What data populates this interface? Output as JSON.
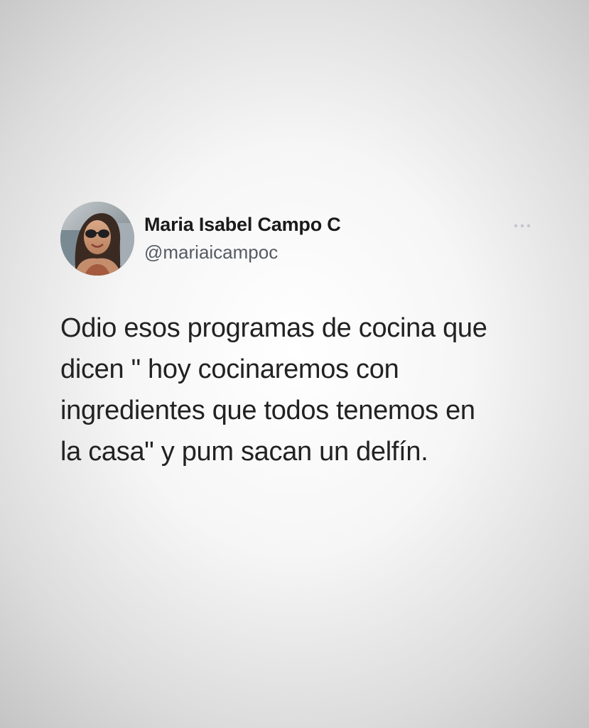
{
  "tweet": {
    "author": {
      "display_name": "Maria Isabel Campo C",
      "handle": "@mariaicampoc",
      "avatar_icon": "profile-photo"
    },
    "more_icon": "more-horizontal-icon",
    "text_lines": [
      "Odio esos programas de cocina que",
      "dicen \" hoy cocinaremos con",
      "ingredientes que todos tenemos en",
      "la casa\" y pum sacan un delfín."
    ]
  },
  "colors": {
    "background": "#f4f4f4",
    "vignette": "#c4c4c4",
    "name_text": "#1a1a1a",
    "handle_text": "#555b61",
    "body_text": "#222222"
  }
}
